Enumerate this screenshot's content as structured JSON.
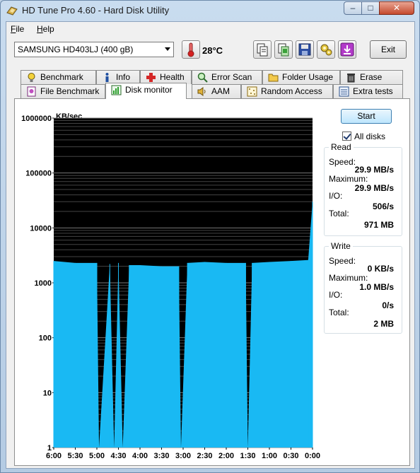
{
  "window": {
    "title": "HD Tune Pro 4.60 - Hard Disk Utility",
    "minimize_glyph": "–",
    "maximize_glyph": "□",
    "close_glyph": "✕"
  },
  "menu": [
    {
      "underline": "F",
      "rest": "ile"
    },
    {
      "underline": "H",
      "rest": "elp"
    }
  ],
  "toolbar": {
    "disk": "SAMSUNG HD403LJ (400 gB)",
    "temperature": "28°C",
    "exit_label": "Exit",
    "icons": [
      "copy-icon",
      "copy-screen-icon",
      "save-icon",
      "options-icon",
      "download-icon"
    ]
  },
  "tabs_row1": [
    {
      "label": "Benchmark",
      "icon": "lightbulb-icon"
    },
    {
      "label": "Info",
      "icon": "info-icon"
    },
    {
      "label": "Health",
      "icon": "health-cross-icon"
    },
    {
      "label": "Error Scan",
      "icon": "magnifier-icon"
    },
    {
      "label": "Folder Usage",
      "icon": "folder-icon"
    },
    {
      "label": "Erase",
      "icon": "trash-icon"
    }
  ],
  "tabs_row2": [
    {
      "label": "File Benchmark",
      "icon": "file-benchmark-icon"
    },
    {
      "label": "Disk monitor",
      "icon": "disk-monitor-icon",
      "active": true
    },
    {
      "label": "AAM",
      "icon": "speaker-icon"
    },
    {
      "label": "Random Access",
      "icon": "random-access-icon"
    },
    {
      "label": "Extra tests",
      "icon": "extra-tests-icon"
    }
  ],
  "controls": {
    "start_label": "Start",
    "all_disks_label": "All disks",
    "all_disks_checked": true
  },
  "read": {
    "title": "Read",
    "speed_label": "Speed:",
    "speed": "29.9 MB/s",
    "maximum_label": "Maximum:",
    "maximum": "29.9 MB/s",
    "io_label": "I/O:",
    "io": "506/s",
    "total_label": "Total:",
    "total": "971 MB"
  },
  "write": {
    "title": "Write",
    "speed_label": "Speed:",
    "speed": "0 KB/s",
    "maximum_label": "Maximum:",
    "maximum": "1.0 MB/s",
    "io_label": "I/O:",
    "io": "0/s",
    "total_label": "Total:",
    "total": "2 MB"
  },
  "chart_data": {
    "type": "area",
    "ylabel": "KB/sec",
    "yscale": "log",
    "ylim": [
      1,
      1000000
    ],
    "yticks": [
      "1000000",
      "100000",
      "10000",
      "1000",
      "100",
      "10",
      "1"
    ],
    "xticks": [
      "6:00",
      "5:30",
      "5:00",
      "4:30",
      "4:00",
      "3:30",
      "3:00",
      "2:30",
      "2:00",
      "1:30",
      "1:00",
      "0:30",
      "0:00"
    ],
    "x_unit": "minutes remaining in window (6:00 oldest, 0:00 newest)",
    "read_color": "#19b9f3",
    "write_color": "#9aa0a0",
    "background": "#000000",
    "read_series": {
      "name": "Read",
      "x": [
        6.0,
        5.5,
        5.0,
        4.95,
        4.7,
        4.6,
        4.5,
        4.4,
        4.25,
        4.0,
        3.5,
        3.1,
        3.05,
        2.9,
        2.5,
        2.0,
        1.55,
        1.5,
        1.4,
        1.0,
        0.5,
        0.1,
        0.0
      ],
      "values": [
        2500,
        2300,
        2300,
        1,
        2200,
        1,
        2300,
        1,
        2100,
        2100,
        2000,
        2000,
        1,
        2300,
        2400,
        2300,
        2300,
        1,
        2300,
        2400,
        2500,
        2600,
        30000
      ]
    },
    "write_series": {
      "name": "Write",
      "values": [
        1,
        1,
        1,
        1,
        1,
        1,
        1,
        1,
        1,
        1,
        1,
        1,
        1,
        1,
        1,
        1,
        1,
        1,
        1,
        1,
        1,
        1,
        1
      ]
    }
  }
}
